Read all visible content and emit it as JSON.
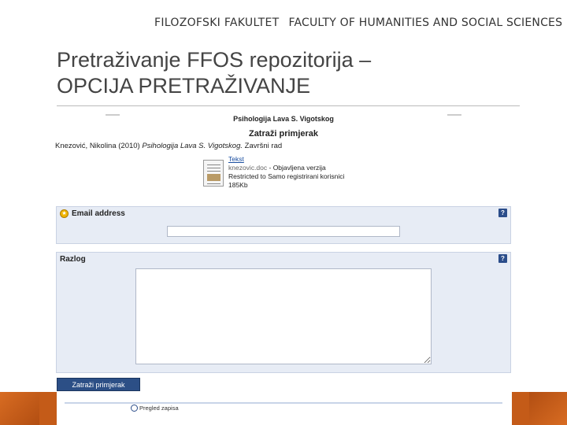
{
  "header": {
    "brand_left": "FILOZOFSKI FAKULTET",
    "brand_right": "FACULTY OF HUMANITIES AND SOCIAL SCIENCES"
  },
  "slide": {
    "title_line1": "Pretraživanje FFOS repozitorija –",
    "title_line2": "OPCIJA PRETRAŽIVANJE"
  },
  "screenshot": {
    "repo_title": "Psihologija Lava S. Vigotskog",
    "page_heading": "Zatraži primjerak",
    "citation_prefix": "Knezović, Nikolina (2010) ",
    "citation_title": "Psihologija Lava S. Vigotskog.",
    "citation_suffix": " Završni rad",
    "document": {
      "link": "Tekst",
      "file_name": "knezovic.doc",
      "version": " - Objavljena verzija",
      "restriction": "Restricted to Samo registrirani korisnici",
      "size": "185Kb"
    },
    "email_panel": {
      "label": "Email address",
      "help": "?",
      "value": ""
    },
    "reason_panel": {
      "label": "Razlog",
      "help": "?",
      "value": ""
    },
    "submit_label": "Zatraži primjerak",
    "footer_link": "Pregled zapisa"
  },
  "colors": {
    "accent_orange": "#c45b18",
    "panel_bg": "#e7ecf5",
    "button_blue": "#2c4f86"
  }
}
